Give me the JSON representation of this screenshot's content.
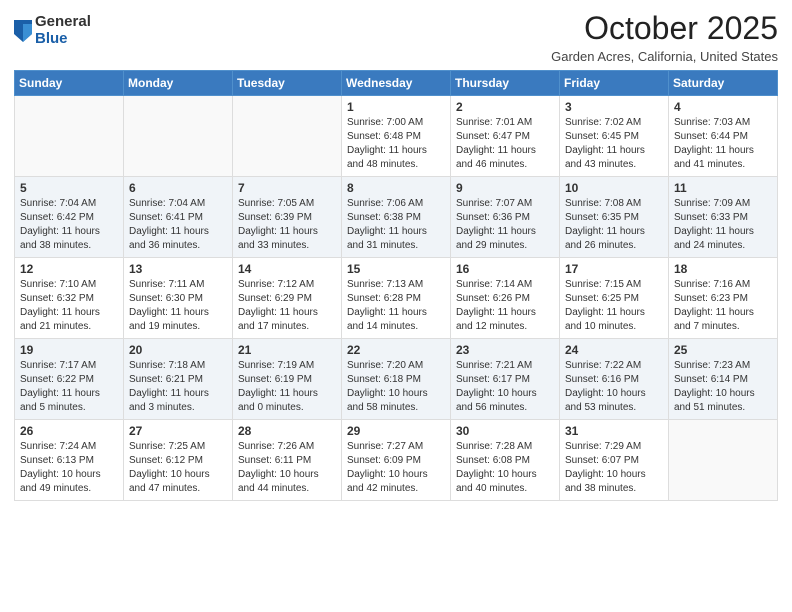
{
  "logo": {
    "general": "General",
    "blue": "Blue"
  },
  "header": {
    "month": "October 2025",
    "location": "Garden Acres, California, United States"
  },
  "weekdays": [
    "Sunday",
    "Monday",
    "Tuesday",
    "Wednesday",
    "Thursday",
    "Friday",
    "Saturday"
  ],
  "weeks": [
    [
      {
        "day": "",
        "info": ""
      },
      {
        "day": "",
        "info": ""
      },
      {
        "day": "",
        "info": ""
      },
      {
        "day": "1",
        "info": "Sunrise: 7:00 AM\nSunset: 6:48 PM\nDaylight: 11 hours\nand 48 minutes."
      },
      {
        "day": "2",
        "info": "Sunrise: 7:01 AM\nSunset: 6:47 PM\nDaylight: 11 hours\nand 46 minutes."
      },
      {
        "day": "3",
        "info": "Sunrise: 7:02 AM\nSunset: 6:45 PM\nDaylight: 11 hours\nand 43 minutes."
      },
      {
        "day": "4",
        "info": "Sunrise: 7:03 AM\nSunset: 6:44 PM\nDaylight: 11 hours\nand 41 minutes."
      }
    ],
    [
      {
        "day": "5",
        "info": "Sunrise: 7:04 AM\nSunset: 6:42 PM\nDaylight: 11 hours\nand 38 minutes."
      },
      {
        "day": "6",
        "info": "Sunrise: 7:04 AM\nSunset: 6:41 PM\nDaylight: 11 hours\nand 36 minutes."
      },
      {
        "day": "7",
        "info": "Sunrise: 7:05 AM\nSunset: 6:39 PM\nDaylight: 11 hours\nand 33 minutes."
      },
      {
        "day": "8",
        "info": "Sunrise: 7:06 AM\nSunset: 6:38 PM\nDaylight: 11 hours\nand 31 minutes."
      },
      {
        "day": "9",
        "info": "Sunrise: 7:07 AM\nSunset: 6:36 PM\nDaylight: 11 hours\nand 29 minutes."
      },
      {
        "day": "10",
        "info": "Sunrise: 7:08 AM\nSunset: 6:35 PM\nDaylight: 11 hours\nand 26 minutes."
      },
      {
        "day": "11",
        "info": "Sunrise: 7:09 AM\nSunset: 6:33 PM\nDaylight: 11 hours\nand 24 minutes."
      }
    ],
    [
      {
        "day": "12",
        "info": "Sunrise: 7:10 AM\nSunset: 6:32 PM\nDaylight: 11 hours\nand 21 minutes."
      },
      {
        "day": "13",
        "info": "Sunrise: 7:11 AM\nSunset: 6:30 PM\nDaylight: 11 hours\nand 19 minutes."
      },
      {
        "day": "14",
        "info": "Sunrise: 7:12 AM\nSunset: 6:29 PM\nDaylight: 11 hours\nand 17 minutes."
      },
      {
        "day": "15",
        "info": "Sunrise: 7:13 AM\nSunset: 6:28 PM\nDaylight: 11 hours\nand 14 minutes."
      },
      {
        "day": "16",
        "info": "Sunrise: 7:14 AM\nSunset: 6:26 PM\nDaylight: 11 hours\nand 12 minutes."
      },
      {
        "day": "17",
        "info": "Sunrise: 7:15 AM\nSunset: 6:25 PM\nDaylight: 11 hours\nand 10 minutes."
      },
      {
        "day": "18",
        "info": "Sunrise: 7:16 AM\nSunset: 6:23 PM\nDaylight: 11 hours\nand 7 minutes."
      }
    ],
    [
      {
        "day": "19",
        "info": "Sunrise: 7:17 AM\nSunset: 6:22 PM\nDaylight: 11 hours\nand 5 minutes."
      },
      {
        "day": "20",
        "info": "Sunrise: 7:18 AM\nSunset: 6:21 PM\nDaylight: 11 hours\nand 3 minutes."
      },
      {
        "day": "21",
        "info": "Sunrise: 7:19 AM\nSunset: 6:19 PM\nDaylight: 11 hours\nand 0 minutes."
      },
      {
        "day": "22",
        "info": "Sunrise: 7:20 AM\nSunset: 6:18 PM\nDaylight: 10 hours\nand 58 minutes."
      },
      {
        "day": "23",
        "info": "Sunrise: 7:21 AM\nSunset: 6:17 PM\nDaylight: 10 hours\nand 56 minutes."
      },
      {
        "day": "24",
        "info": "Sunrise: 7:22 AM\nSunset: 6:16 PM\nDaylight: 10 hours\nand 53 minutes."
      },
      {
        "day": "25",
        "info": "Sunrise: 7:23 AM\nSunset: 6:14 PM\nDaylight: 10 hours\nand 51 minutes."
      }
    ],
    [
      {
        "day": "26",
        "info": "Sunrise: 7:24 AM\nSunset: 6:13 PM\nDaylight: 10 hours\nand 49 minutes."
      },
      {
        "day": "27",
        "info": "Sunrise: 7:25 AM\nSunset: 6:12 PM\nDaylight: 10 hours\nand 47 minutes."
      },
      {
        "day": "28",
        "info": "Sunrise: 7:26 AM\nSunset: 6:11 PM\nDaylight: 10 hours\nand 44 minutes."
      },
      {
        "day": "29",
        "info": "Sunrise: 7:27 AM\nSunset: 6:09 PM\nDaylight: 10 hours\nand 42 minutes."
      },
      {
        "day": "30",
        "info": "Sunrise: 7:28 AM\nSunset: 6:08 PM\nDaylight: 10 hours\nand 40 minutes."
      },
      {
        "day": "31",
        "info": "Sunrise: 7:29 AM\nSunset: 6:07 PM\nDaylight: 10 hours\nand 38 minutes."
      },
      {
        "day": "",
        "info": ""
      }
    ]
  ]
}
